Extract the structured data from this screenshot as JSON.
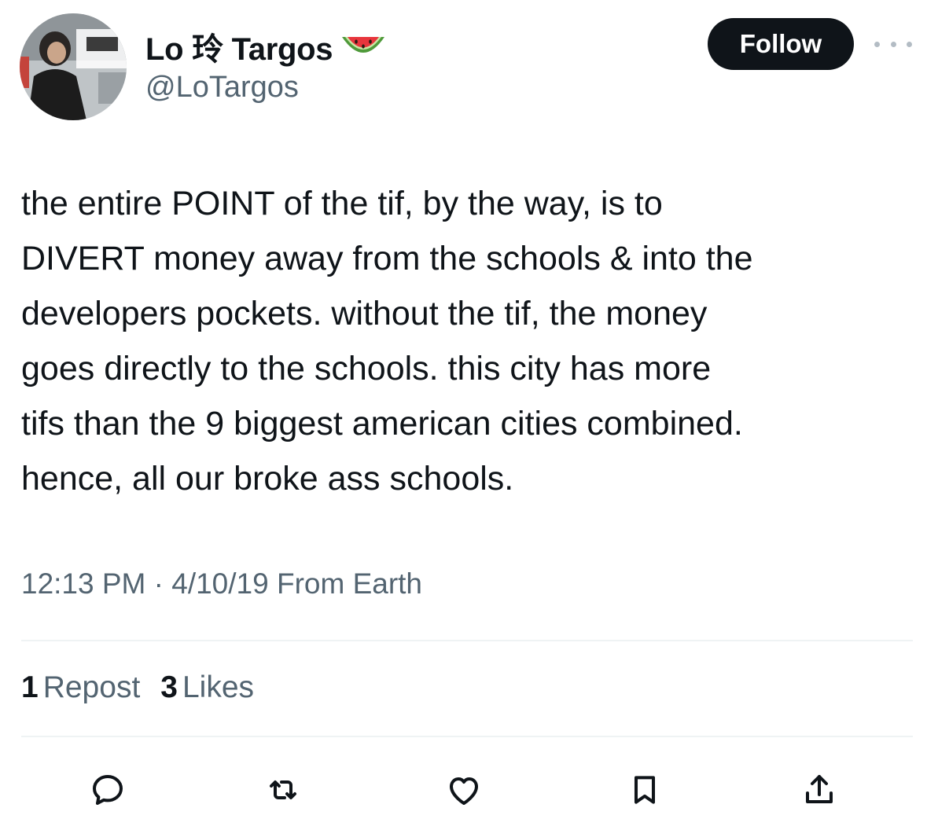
{
  "author": {
    "display_name": "Lo 玲 Targos",
    "emoji_icon": "watermelon-icon",
    "handle": "@LoTargos",
    "avatar_icon": "profile-photo"
  },
  "header": {
    "follow_label": "Follow",
    "more_icon": "more-dots-icon"
  },
  "tweet": {
    "lines": [
      "the entire POINT of the tif, by the way, is to",
      "DIVERT money away from the schools & into the",
      "developers pockets. without the tif, the money",
      "goes directly to the schools. this city has more",
      "tifs than the 9 biggest american cities combined.",
      "hence, all our broke ass schools."
    ],
    "timestamp": "12:13 PM · 4/10/19 From Earth"
  },
  "stats": {
    "reposts_count": "1",
    "reposts_label": "Repost",
    "likes_count": "3",
    "likes_label": "Likes"
  },
  "actions": [
    "reply-icon",
    "retweet-icon",
    "like-icon",
    "bookmark-icon",
    "share-icon"
  ],
  "colors": {
    "text": "#0f1419",
    "secondary": "#536471",
    "divider": "#eff3f4",
    "button_bg": "#0f1419",
    "button_text": "#ffffff"
  }
}
